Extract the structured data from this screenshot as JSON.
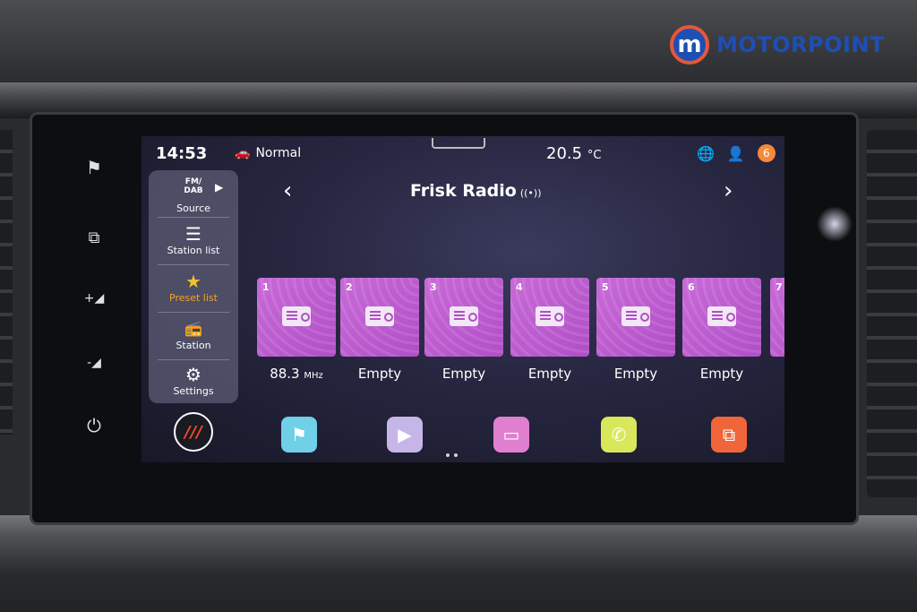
{
  "brand": {
    "logo_letter": "m",
    "name": "MOTORPOINT"
  },
  "hardware_buttons": [
    {
      "name": "flag-icon",
      "glyph": "⚑"
    },
    {
      "name": "screen-mirror-icon",
      "glyph": "⧉"
    },
    {
      "name": "volume-up-icon",
      "glyph": "+◢"
    },
    {
      "name": "volume-down-icon",
      "glyph": "-◢"
    },
    {
      "name": "power-icon",
      "glyph": "⏻"
    }
  ],
  "status": {
    "time": "14:53",
    "drive_mode": "Normal",
    "temperature": "20.5",
    "temp_unit": "°C",
    "notification_count": "6"
  },
  "side_menu": {
    "source": {
      "icon": "FM/ DAB",
      "label": "Source"
    },
    "station_list": {
      "icon": "☰",
      "label": "Station list"
    },
    "preset_list": {
      "icon": "★",
      "label": "Preset list"
    },
    "station": {
      "icon": "📻",
      "label": "Station"
    },
    "settings": {
      "icon": "⚙",
      "label": "Settings"
    }
  },
  "station": {
    "title": "Frisk Radio",
    "signal": "((•))",
    "prev": "‹",
    "next": "›"
  },
  "presets": [
    {
      "num": "1",
      "freq": "88.3",
      "unit": "MHz"
    },
    {
      "num": "2",
      "label": "Empty"
    },
    {
      "num": "3",
      "label": "Empty"
    },
    {
      "num": "4",
      "label": "Empty"
    },
    {
      "num": "5",
      "label": "Empty"
    },
    {
      "num": "6",
      "label": "Empty"
    },
    {
      "num": "7"
    }
  ],
  "dock": {
    "home_glyph": "///",
    "apps": [
      {
        "name": "navigation-app-icon",
        "glyph": "⚑",
        "color": "#6fd0e8"
      },
      {
        "name": "media-app-icon",
        "glyph": "▶",
        "color": "#c6b6e8"
      },
      {
        "name": "radio-app-icon",
        "glyph": "▭",
        "color": "#e07fd0"
      },
      {
        "name": "phone-app-icon",
        "glyph": "✆",
        "color": "#d8e85a"
      },
      {
        "name": "connect-app-icon",
        "glyph": "⧉",
        "color": "#f0653a"
      }
    ]
  },
  "accent_colors": {
    "active_menu": "#f3a52b",
    "preset_tile": "#c86ad8",
    "notification": "#f58a3a"
  }
}
